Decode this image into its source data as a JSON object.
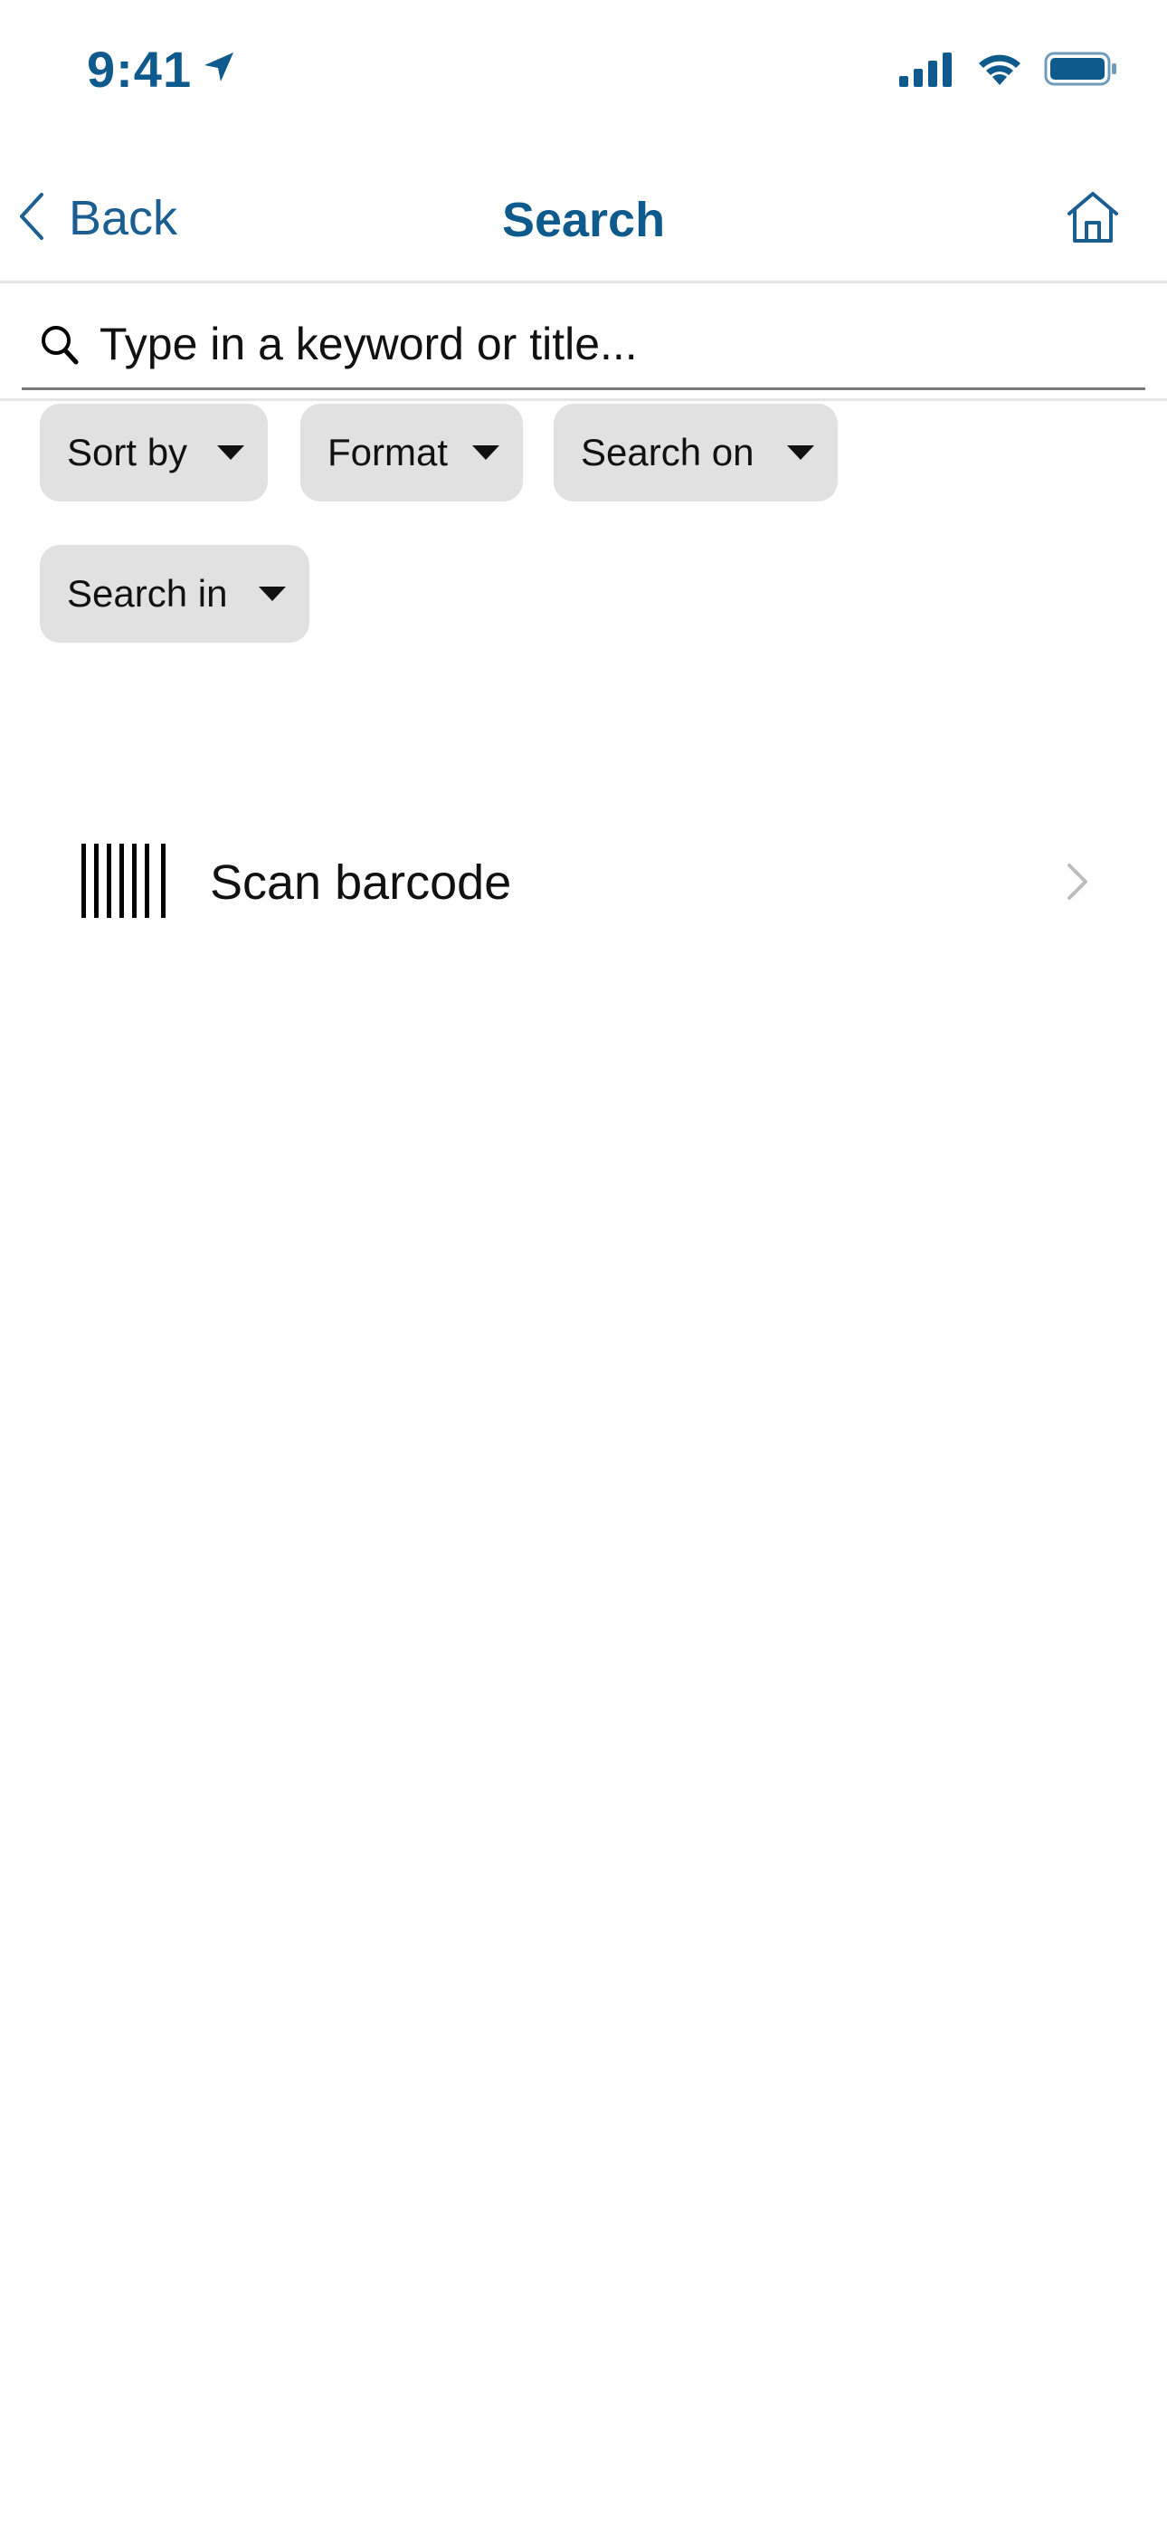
{
  "status_bar": {
    "time": "9:41",
    "time_color": "#0f5a8c",
    "icons": [
      "location-arrow-icon",
      "cellular-signal-icon",
      "wifi-icon",
      "battery-icon"
    ]
  },
  "nav": {
    "back_label": "Back",
    "title": "Search",
    "back_icon": "chevron-left-icon",
    "home_icon": "home-icon",
    "accent_color": "#1a5e92"
  },
  "search": {
    "placeholder": "Type in a keyword or title...",
    "value": "",
    "icon": "search-icon"
  },
  "filters": [
    {
      "label": "Sort by"
    },
    {
      "label": "Format"
    },
    {
      "label": "Search on"
    },
    {
      "label": "Search in"
    }
  ],
  "scan": {
    "label": "Scan barcode",
    "icon": "barcode-icon",
    "trailing_icon": "chevron-right-icon"
  }
}
